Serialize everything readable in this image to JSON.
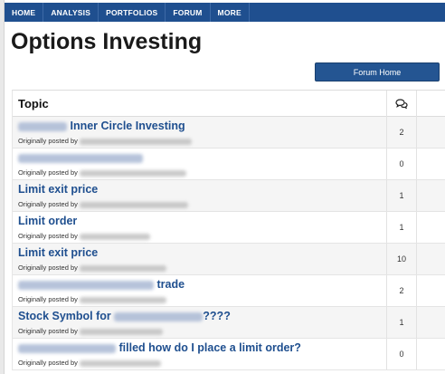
{
  "nav": {
    "items": [
      "HOME",
      "ANALYSIS",
      "PORTFOLIOS",
      "FORUM",
      "MORE"
    ]
  },
  "page": {
    "title": "Options Investing",
    "forum_home_label": "Forum Home"
  },
  "table": {
    "header_topic": "Topic",
    "replies_icon": "speech-bubbles-icon",
    "byline_prefix": "Originally posted by",
    "rows": [
      {
        "title_pre": "",
        "title": "Inner Circle Investing",
        "replies": "2"
      },
      {
        "title_pre": "",
        "title": "",
        "replies": "0"
      },
      {
        "title_pre": "",
        "title": "Limit exit price",
        "replies": "1"
      },
      {
        "title_pre": "",
        "title": "Limit order",
        "replies": "1"
      },
      {
        "title_pre": "",
        "title": "Limit exit price",
        "replies": "10"
      },
      {
        "title_pre": "",
        "title": "trade",
        "replies": "2"
      },
      {
        "title_pre": "Stock Symbol for",
        "title": "????",
        "replies": "1"
      },
      {
        "title_pre": "",
        "title": "filled how do I place a limit order?",
        "replies": "0"
      }
    ]
  }
}
